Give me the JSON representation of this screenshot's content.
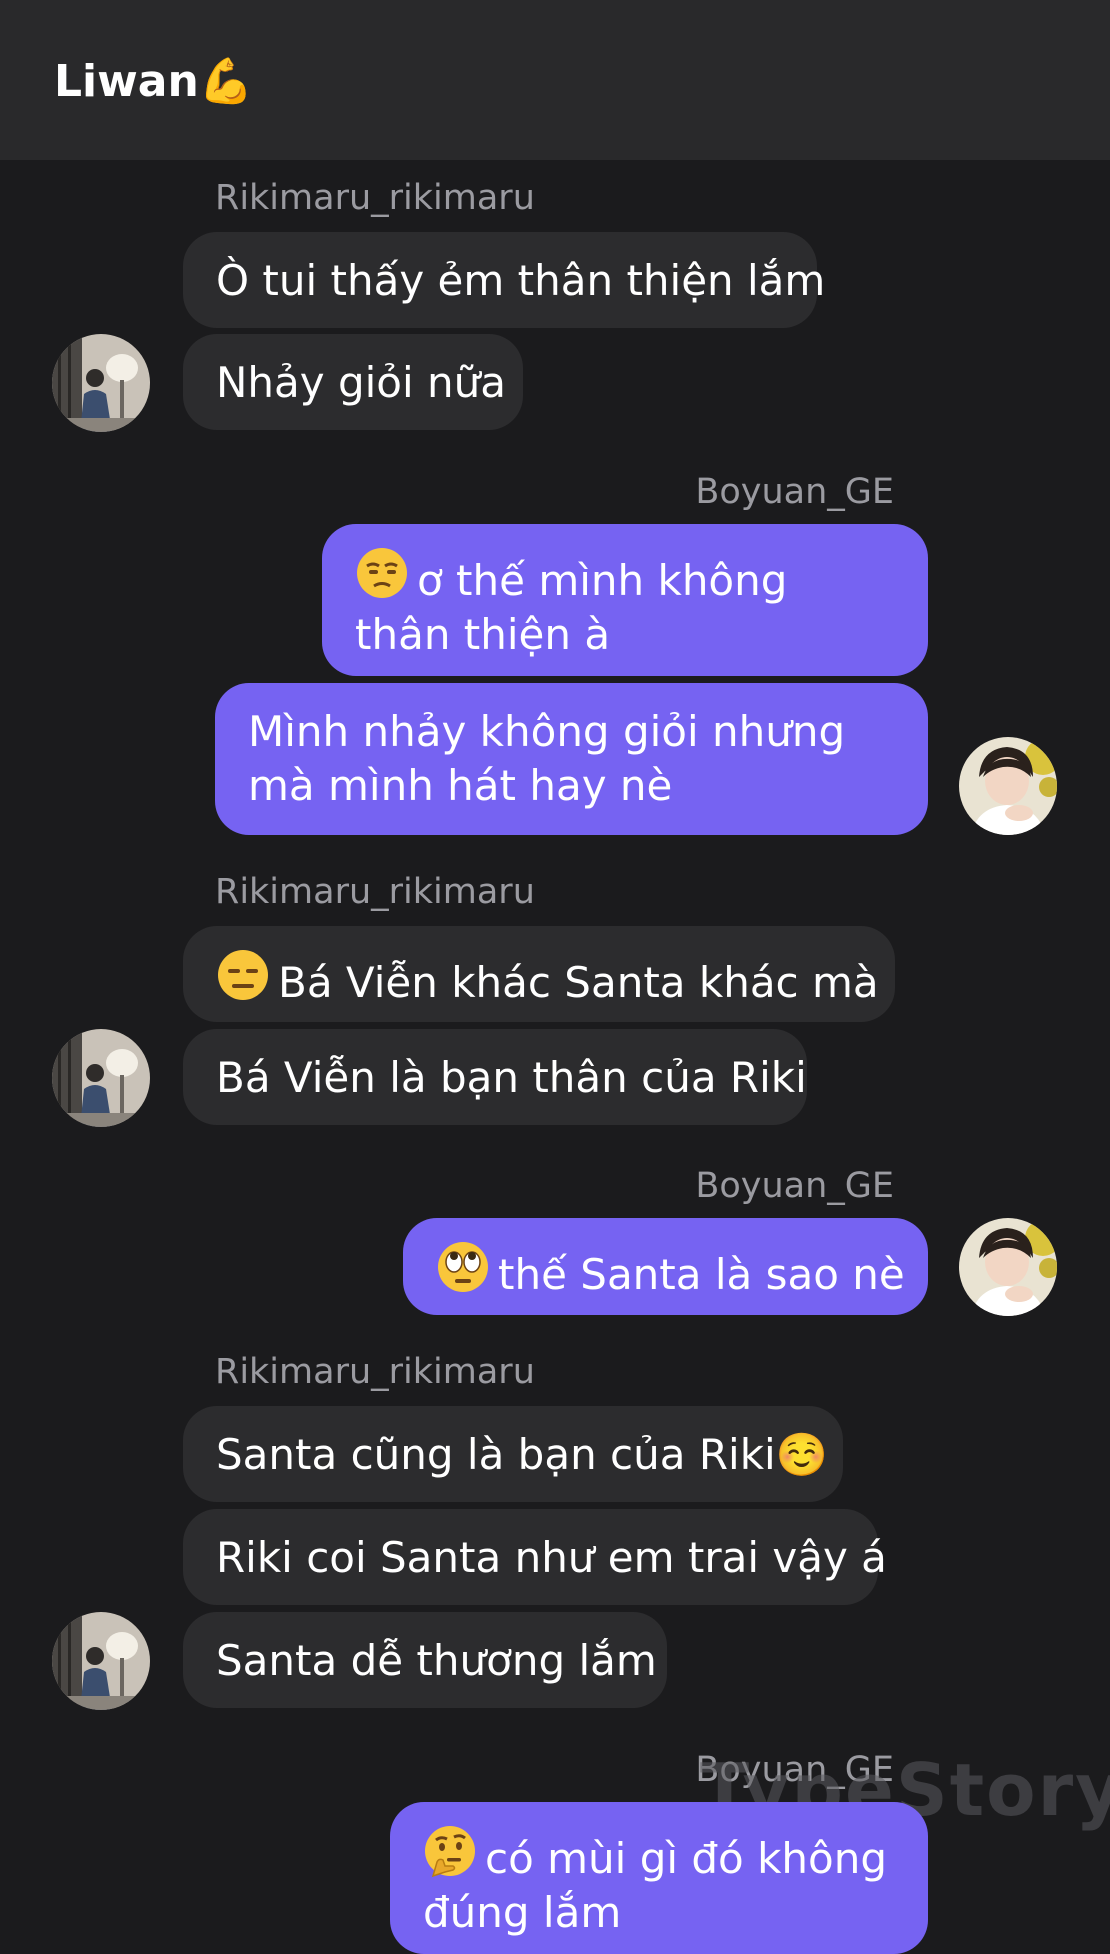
{
  "header": {
    "title": "Liwan💪"
  },
  "senders": {
    "rikimaru": "Rikimaru_rikimaru",
    "boyuan": "Boyuan_GE"
  },
  "messages": [
    {
      "from": "rikimaru",
      "text": "Ò tui thấy ẻm thân thiện lắm"
    },
    {
      "from": "rikimaru",
      "text": "Nhảy giỏi nữa"
    },
    {
      "from": "boyuan",
      "emoji": "unamused-face",
      "text": "ơ thế mình không thân thiện à"
    },
    {
      "from": "boyuan",
      "text": "Mình nhảy không giỏi nhưng mà mình hát hay nè"
    },
    {
      "from": "rikimaru",
      "emoji": "expressionless-face",
      "text": "Bá Viễn khác Santa khác mà"
    },
    {
      "from": "rikimaru",
      "text": "Bá Viễn là bạn thân của Riki"
    },
    {
      "from": "boyuan",
      "emoji": "eye-roll-face",
      "text": "thế Santa là sao nè"
    },
    {
      "from": "rikimaru",
      "text": "Santa cũng là bạn của Riki☺️"
    },
    {
      "from": "rikimaru",
      "text": "Riki coi Santa như em trai vậy á"
    },
    {
      "from": "rikimaru",
      "text": "Santa dễ thương lắm"
    },
    {
      "from": "boyuan",
      "emoji": "thinking-face",
      "text": "có mùi gì đó không đúng lắm"
    }
  ],
  "watermark": "TypeStory",
  "colors": {
    "background": "#1b1b1d",
    "header": "#29292b",
    "incoming_bubble": "#2c2c2e",
    "outgoing_bubble": "#7663f2",
    "sender_name": "#9b9ba1"
  }
}
